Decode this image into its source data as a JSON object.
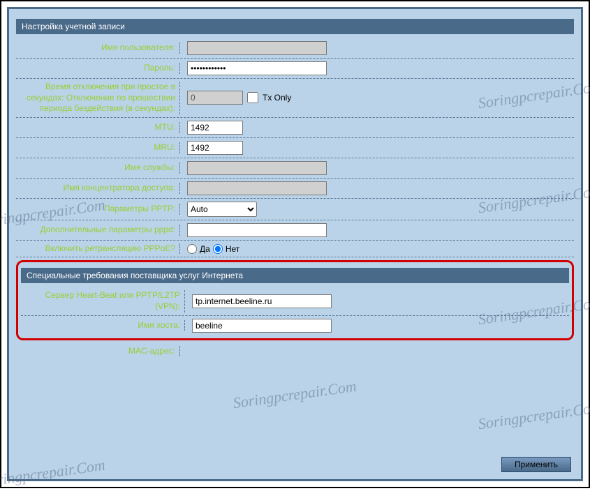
{
  "watermark": "Soringpcrepair.Com",
  "section1": {
    "title": "Настройка учетной записи",
    "username_label": "Имя пользователя:",
    "username_value": "",
    "password_label": "Пароль:",
    "password_value": "••••••••••••",
    "idle_label": "Время отключения при простое в секундах: Отключение по прошествии периода бездействия (в секундах):",
    "idle_value": "0",
    "txonly_label": "Tx Only",
    "mtu_label": "MTU:",
    "mtu_value": "1492",
    "mru_label": "MRU:",
    "mru_value": "1492",
    "service_label": "Имя службы:",
    "service_value": "",
    "concentrator_label": "Имя концентратора доступа:",
    "concentrator_value": "",
    "pptp_label": "Параметры PPTP:",
    "pptp_value": "Auto",
    "pppd_label": "Дополнительные параметры pppd:",
    "pppd_value": "",
    "relay_label": "Включить ретрансляцию PPPoE?",
    "relay_yes": "Да",
    "relay_no": "Нет"
  },
  "section2": {
    "title": "Специальные требования поставщика услуг Интернета",
    "heartbeat_label": "Сервер Heart-Beat или PPTP/L2TP (VPN):",
    "heartbeat_value": "tp.internet.beeline.ru",
    "hostname_label": "Имя хоста:",
    "hostname_value": "beeline",
    "mac_label": "MAC-адрес:"
  },
  "apply_button": "Применить"
}
